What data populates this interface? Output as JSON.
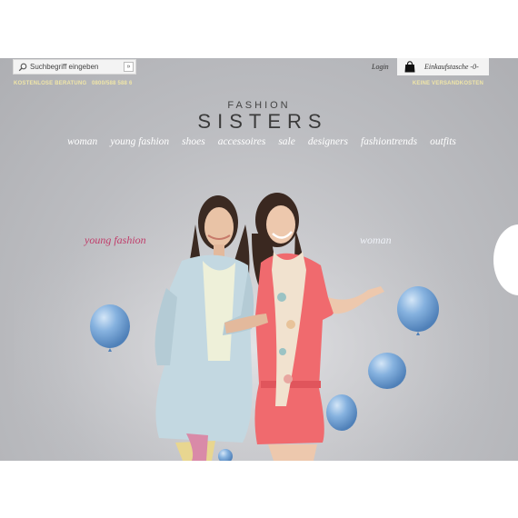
{
  "search": {
    "placeholder": "Suchbegriff eingeben",
    "submit_label": "»"
  },
  "header": {
    "login_label": "Login",
    "cart_label": "Einkaufstasche -0-",
    "consult_label": "KOSTENLOSE BERATUNG",
    "phone": "0800/588 588 6",
    "shipping_label": "KEINE VERSANDKOSTEN"
  },
  "logo": {
    "top": "FASHION",
    "main": "SISTERS"
  },
  "nav": {
    "items": [
      "woman",
      "young fashion",
      "shoes",
      "accessoires",
      "sale",
      "designers",
      "fashiontrends",
      "outfits"
    ]
  },
  "hero": {
    "left_label": "young fashion",
    "right_label": "woman",
    "left_label_color": "#c03d6a",
    "right_label_color": "#eef1f7"
  },
  "colors": {
    "background": "#bcbdc1",
    "info_text": "#f0e6a8",
    "balloon": "#7aa6d6",
    "dress": "#f06a6e",
    "coat": "#bcd3dc"
  }
}
